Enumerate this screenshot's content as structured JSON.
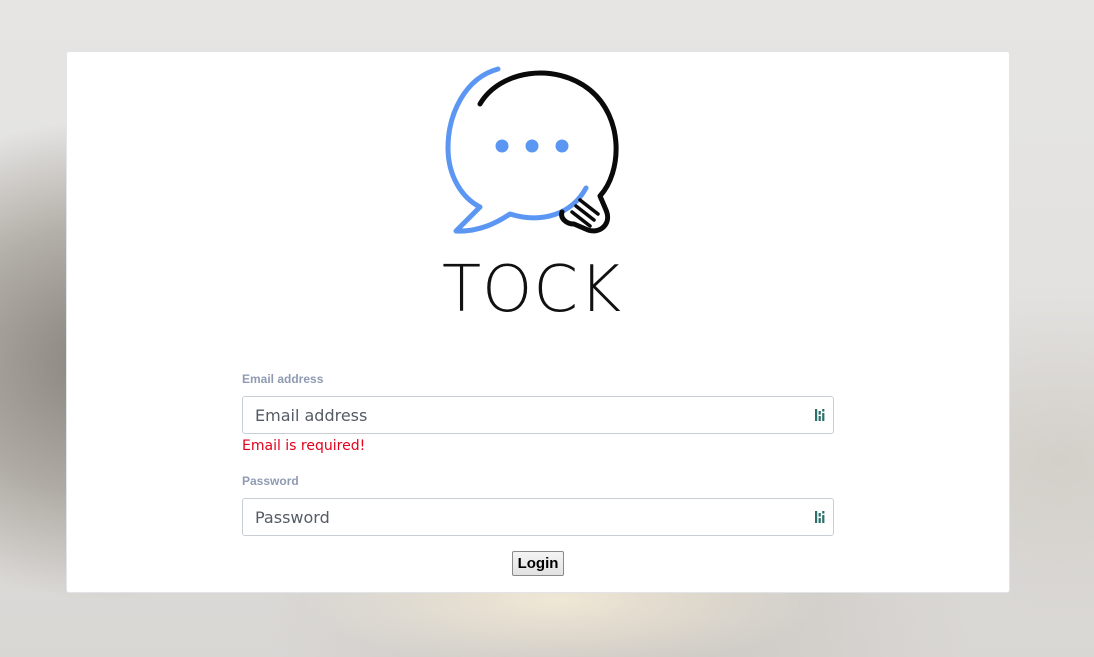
{
  "brand": {
    "name": "TOCK",
    "logo_icon": "chat-bubble-lightbulb-icon",
    "colors": {
      "bubble_blue": "#5b97f2",
      "bulb_black": "#0a0a0a"
    }
  },
  "form": {
    "email": {
      "label": "Email address",
      "placeholder": "Email address",
      "value": "",
      "error": "Email is required!",
      "icon": "password-manager-icon"
    },
    "password": {
      "label": "Password",
      "placeholder": "Password",
      "value": "",
      "icon": "password-manager-icon"
    },
    "submit_label": "Login"
  },
  "colors": {
    "label": "#8f9bb3",
    "error": "#e3001b",
    "card": "#ffffff"
  }
}
